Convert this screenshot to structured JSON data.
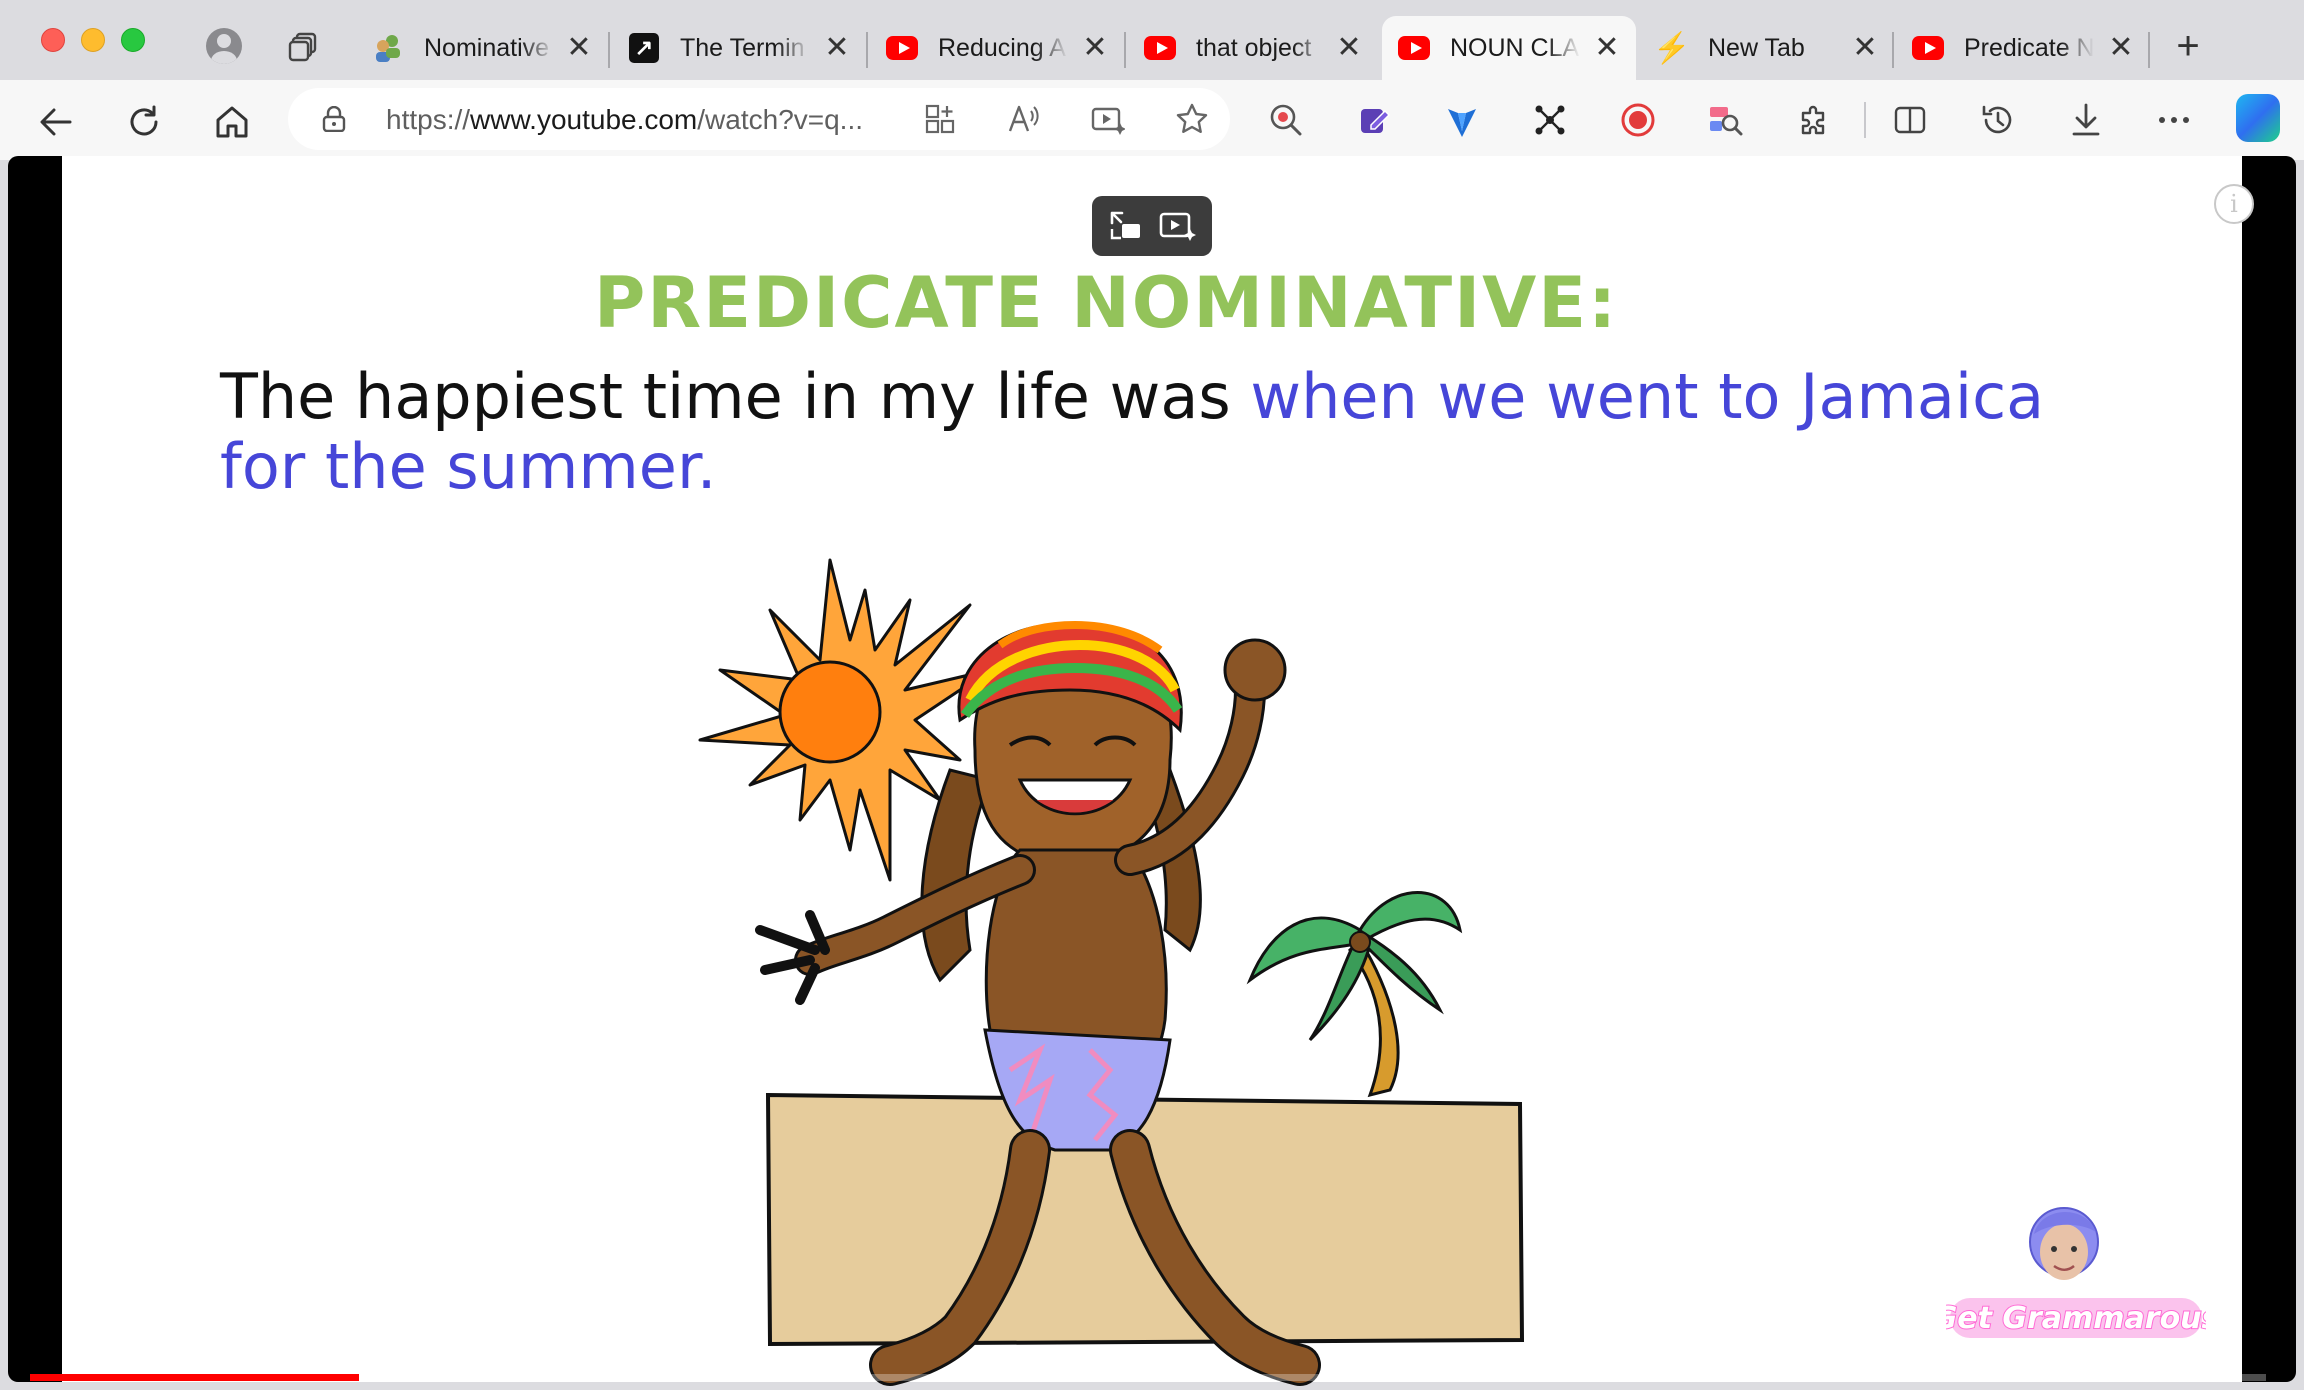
{
  "browser": {
    "tabs": [
      {
        "title": "Nominative",
        "icon": "grammar-people-icon"
      },
      {
        "title": "The Termin",
        "icon": "arrow-icon"
      },
      {
        "title": "Reducing A",
        "icon": "youtube-icon"
      },
      {
        "title": "that object",
        "icon": "youtube-icon"
      },
      {
        "title": "NOUN CLA",
        "icon": "youtube-icon",
        "active": true
      },
      {
        "title": "New Tab",
        "icon": "bolt-icon"
      },
      {
        "title": "Predicate N",
        "icon": "youtube-icon"
      }
    ],
    "close_glyph": "✕",
    "new_tab_glyph": "+"
  },
  "address_bar": {
    "url_prefix": "https://",
    "url_host": "www.youtube.com",
    "url_path": "/watch?v=q..."
  },
  "video": {
    "heading": "PREDICATE NOMINATIVE:",
    "sentence_plain": "The happiest time in my life was ",
    "sentence_clause": "when we went to Jamaica for the summer.",
    "info_glyph": "i",
    "brand": "Get Grammarous",
    "progress": 0.147
  },
  "colors": {
    "heading": "#93c35a",
    "clause": "#4646d8",
    "progress": "#ff0000",
    "brand": "#ff6ad5"
  }
}
